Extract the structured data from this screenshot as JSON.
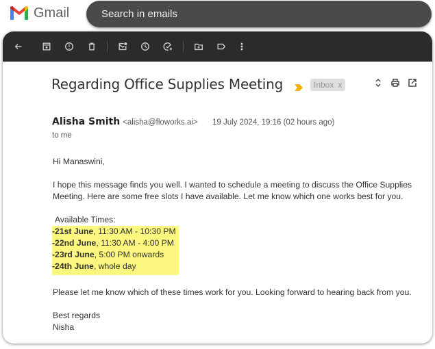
{
  "app": {
    "name": "Gmail"
  },
  "search": {
    "placeholder": "Search in emails"
  },
  "toolbar": {
    "icons": [
      "back-arrow-icon",
      "archive-icon",
      "report-spam-icon",
      "delete-icon",
      "mark-unread-icon",
      "snooze-icon",
      "add-task-icon",
      "move-to-icon",
      "label-icon",
      "more-options-icon"
    ]
  },
  "email": {
    "subject": "Regarding Office Supplies Meeting",
    "label": "Inbox",
    "label_close": "x",
    "sender_name": "Alisha Smith",
    "sender_email": "<alisha@floworks.ai>",
    "date": "19 July 2024, 19:16 (02 hours ago)",
    "recipient": "to me",
    "greeting": "Hi Manaswini,",
    "paragraph1": "I hope this message finds you well. I wanted to schedule a meeting to discuss the Office Supplies Meeting.  Here are some free slots I have available.  Let me know which one works best for you.",
    "times_label": "Available Times:",
    "times": [
      {
        "day": "-21st June",
        "slot": ", 11:30 AM - 10:30 PM"
      },
      {
        "day": "-22nd June",
        "slot": ", 11:30 AM - 4:00 PM"
      },
      {
        "day": "-23rd June",
        "slot": ", 5:00 PM onwards"
      },
      {
        "day": "-24th June",
        "slot": ", whole day"
      }
    ],
    "paragraph2": "Please let me know which of these times work for you. Looking forward to hearing back from you.",
    "signoff": "Best regards",
    "signature": "Nisha"
  },
  "colors": {
    "highlight": "#fbf77e",
    "important_marker": "#f4b400",
    "toolbar_bg": "#2b2b2b",
    "search_bg": "#4a4a4a"
  }
}
